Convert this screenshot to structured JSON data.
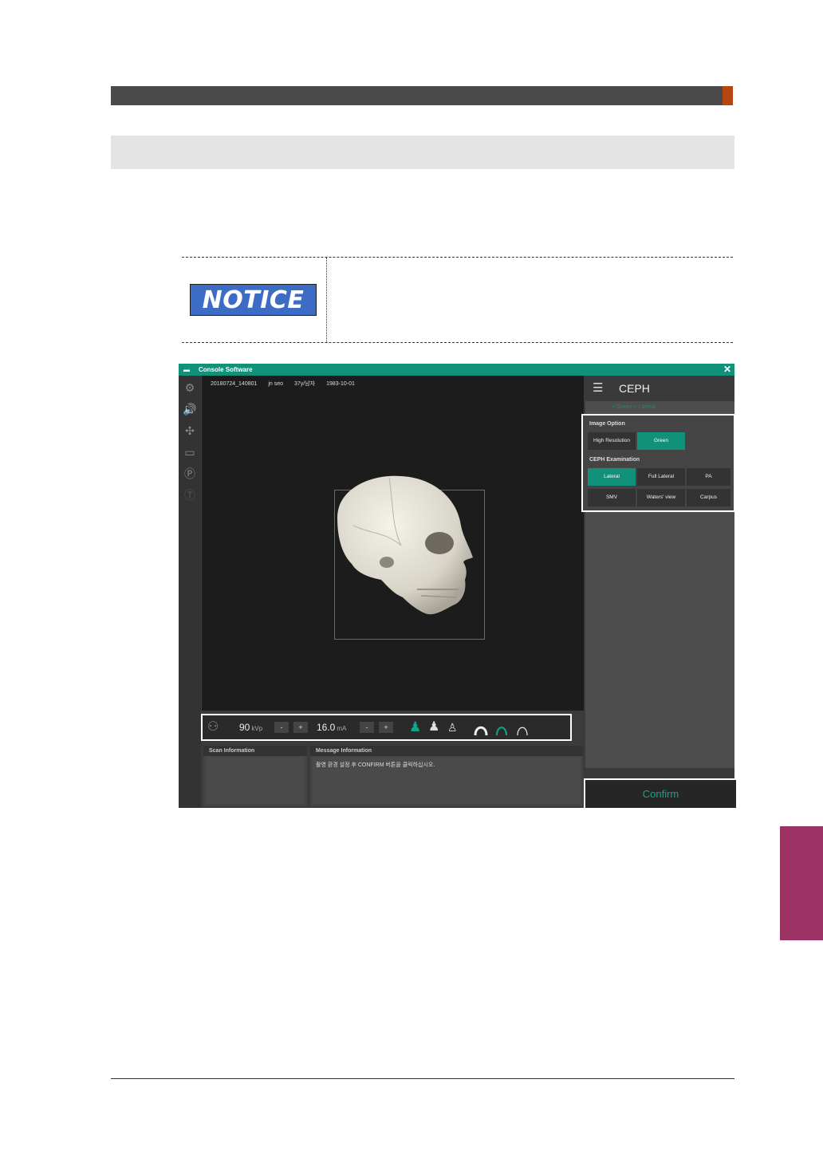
{
  "notice": {
    "label": "NOTICE"
  },
  "window": {
    "title": "Console Software",
    "close_glyph": "✕"
  },
  "toolbar": {
    "icons": [
      "gear-icon",
      "speaker-icon",
      "laser-icon",
      "monitor-icon",
      "p-circle-icon",
      "t-circle-icon"
    ]
  },
  "patient": {
    "id": "20180724_140801",
    "name": "jn seo",
    "age_gender": "37y/남자",
    "dob": "1983-10-01"
  },
  "controls": {
    "kvp_value": "90",
    "kvp_unit": "kVp",
    "ma_value": "16.0",
    "ma_unit": "mA",
    "minus": "-",
    "plus": "+"
  },
  "scan_info": {
    "header": "Scan Information"
  },
  "message_info": {
    "header": "Message Information",
    "text": "촬영 환경 설정 후 CONFIRM 버튼을 클릭하십시오."
  },
  "panel": {
    "title": "CEPH",
    "breadcrumb": "> Green > Lateral",
    "image_option": {
      "label": "Image Option",
      "buttons": [
        {
          "label": "High Resolution",
          "active": false
        },
        {
          "label": "Green",
          "active": true
        }
      ]
    },
    "examination": {
      "label": "CEPH Examination",
      "buttons": [
        {
          "label": "Lateral",
          "active": true
        },
        {
          "label": "Full Lateral",
          "active": false
        },
        {
          "label": "PA",
          "active": false
        },
        {
          "label": "SMV",
          "active": false
        },
        {
          "label": "Waters' view",
          "active": false
        },
        {
          "label": "Carpus",
          "active": false
        }
      ]
    }
  },
  "confirm": {
    "label": "Confirm"
  },
  "colors": {
    "accent": "#11907a",
    "notice": "#3c6cc4",
    "side_tab": "#9c3264",
    "header_accent": "#b6460f"
  }
}
